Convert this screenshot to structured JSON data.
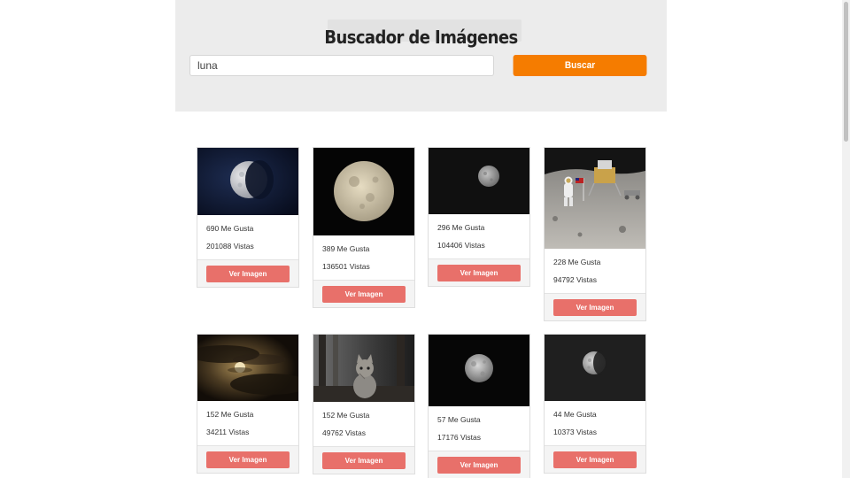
{
  "header": {
    "title": "Buscador de Imágenes",
    "search_value": "luna",
    "search_button": "Buscar",
    "button_color": "#f57c00"
  },
  "results": [
    {
      "likes": "690 Me Gusta",
      "views": "201088 Vistas",
      "button": "Ver Imagen",
      "image": "moon-half-blue-sky"
    },
    {
      "likes": "389 Me Gusta",
      "views": "136501 Vistas",
      "button": "Ver Imagen",
      "image": "full-moon"
    },
    {
      "likes": "296 Me Gusta",
      "views": "104406 Vistas",
      "button": "Ver Imagen",
      "image": "small-moon-dark"
    },
    {
      "likes": "228 Me Gusta",
      "views": "94792 Vistas",
      "button": "Ver Imagen",
      "image": "astronaut-lunar-surface"
    },
    {
      "likes": "152 Me Gusta",
      "views": "34211 Vistas",
      "button": "Ver Imagen",
      "image": "moon-behind-clouds"
    },
    {
      "likes": "152 Me Gusta",
      "views": "49762 Vistas",
      "button": "Ver Imagen",
      "image": "cat-by-window"
    },
    {
      "likes": "57 Me Gusta",
      "views": "17176 Vistas",
      "button": "Ver Imagen",
      "image": "moon-black-sky"
    },
    {
      "likes": "44 Me Gusta",
      "views": "10373 Vistas",
      "button": "Ver Imagen",
      "image": "gibbous-moon"
    }
  ],
  "colors": {
    "accent": "#f57c00",
    "card_button": "#e8706a",
    "header_bg": "#ececec"
  }
}
